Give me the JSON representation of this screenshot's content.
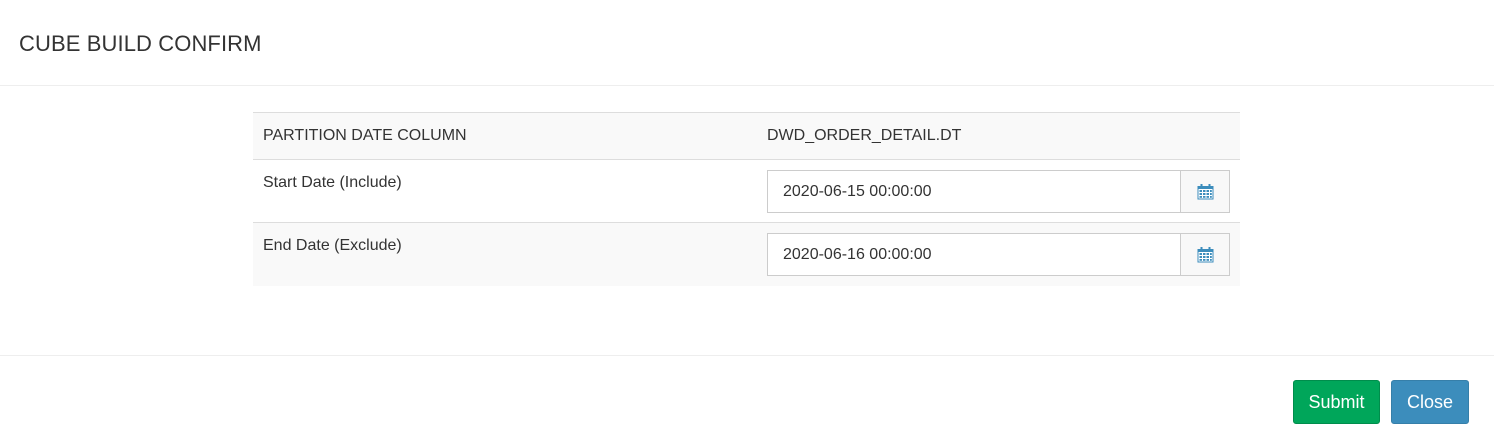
{
  "modal": {
    "title": "CUBE BUILD CONFIRM"
  },
  "table": {
    "partition": {
      "label": "PARTITION DATE COLUMN",
      "value": "DWD_ORDER_DETAIL.DT"
    },
    "start_date": {
      "label": "Start Date (Include)",
      "value": "2020-06-15 00:00:00",
      "icon": "calendar-icon"
    },
    "end_date": {
      "label": "End Date (Exclude)",
      "value": "2020-06-16 00:00:00",
      "icon": "calendar-icon"
    }
  },
  "footer": {
    "submit_label": "Submit",
    "close_label": "Close"
  },
  "colors": {
    "submit": "#00a65a",
    "close": "#3c8dbc",
    "calendar_icon": "#3c8dbc"
  }
}
